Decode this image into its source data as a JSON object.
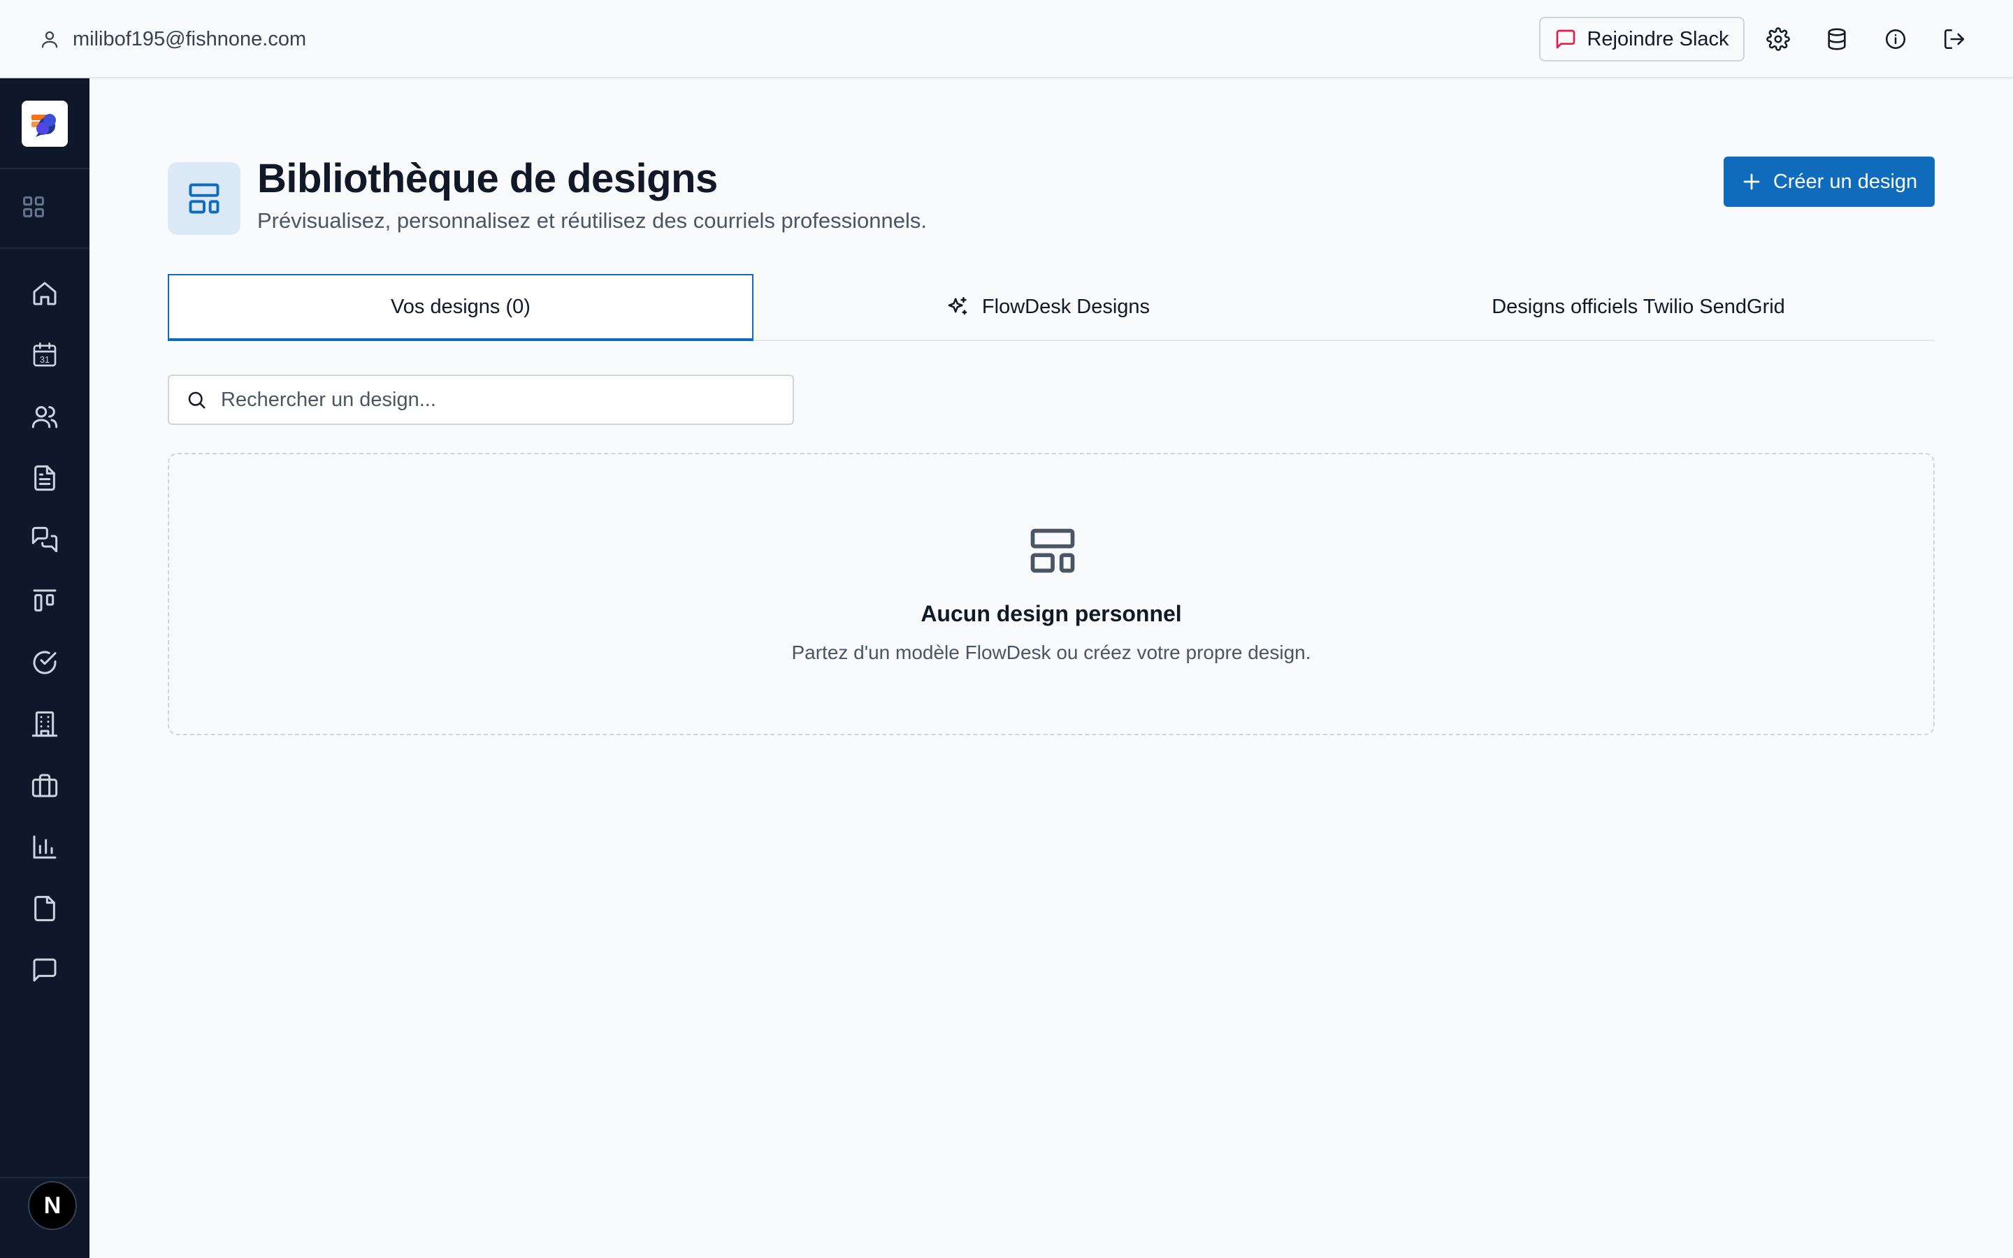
{
  "topbar": {
    "user_email": "milibof195@fishnone.com",
    "slack_label": "Rejoindre Slack",
    "icons": [
      "user-icon",
      "message-square-icon",
      "settings-icon",
      "database-icon",
      "info-icon",
      "logout-icon"
    ]
  },
  "sidebar": {
    "items": [
      {
        "name": "home",
        "icon": "home-icon"
      },
      {
        "name": "calendar",
        "icon": "calendar-icon",
        "badge": "31"
      },
      {
        "name": "contacts",
        "icon": "users-icon"
      },
      {
        "name": "documents",
        "icon": "file-text-icon"
      },
      {
        "name": "conversations",
        "icon": "messages-icon"
      },
      {
        "name": "pipeline",
        "icon": "kanban-icon"
      },
      {
        "name": "tasks",
        "icon": "check-circle-icon"
      },
      {
        "name": "companies",
        "icon": "building-icon"
      },
      {
        "name": "deals",
        "icon": "briefcase-icon"
      },
      {
        "name": "reports",
        "icon": "bar-chart-icon"
      },
      {
        "name": "files",
        "icon": "file-icon"
      },
      {
        "name": "chat",
        "icon": "message-icon"
      }
    ],
    "avatar_letter": "N"
  },
  "header": {
    "title": "Bibliothèque de designs",
    "subtitle": "Prévisualisez, personnalisez et réutilisez des courriels professionnels.",
    "create_label": "Créer un design"
  },
  "tabs": [
    {
      "label": "Vos designs (0)",
      "active": true
    },
    {
      "label": "FlowDesk Designs",
      "active": false
    },
    {
      "label": "Designs officiels Twilio SendGrid",
      "active": false
    }
  ],
  "search": {
    "placeholder": "Rechercher un design..."
  },
  "empty_state": {
    "title": "Aucun design personnel",
    "text": "Partez d'un modèle FlowDesk ou créez votre propre design."
  },
  "colors": {
    "accent": "#0f6cbd",
    "sidebar_bg": "#0f172a",
    "page_bg": "#f8fafc",
    "slack_icon": "#e11d48"
  }
}
